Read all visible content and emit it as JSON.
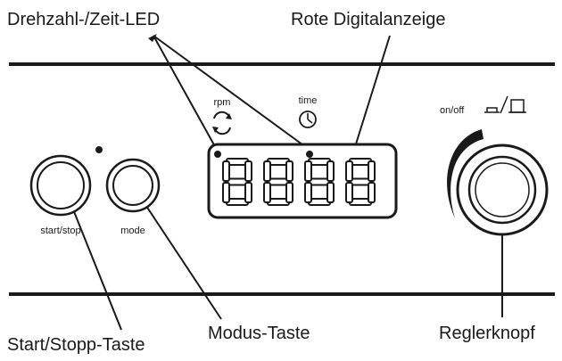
{
  "callouts": {
    "led": "Drehzahl-/Zeit-LED",
    "display": "Rote Digitalanzeige",
    "start_stop": "Start/Stopp-Taste",
    "mode": "Modus-Taste",
    "knob": "Reglerknopf"
  },
  "panel": {
    "start_stop_label": "start/stop",
    "mode_label": "mode",
    "rpm_label": "rpm",
    "time_label": "time",
    "onoff_label": "on/off",
    "display_digits": "8888"
  },
  "icons": {
    "rpm": "rotate-arrows-icon",
    "time": "clock-icon",
    "onoff": "power-switch-icon"
  }
}
